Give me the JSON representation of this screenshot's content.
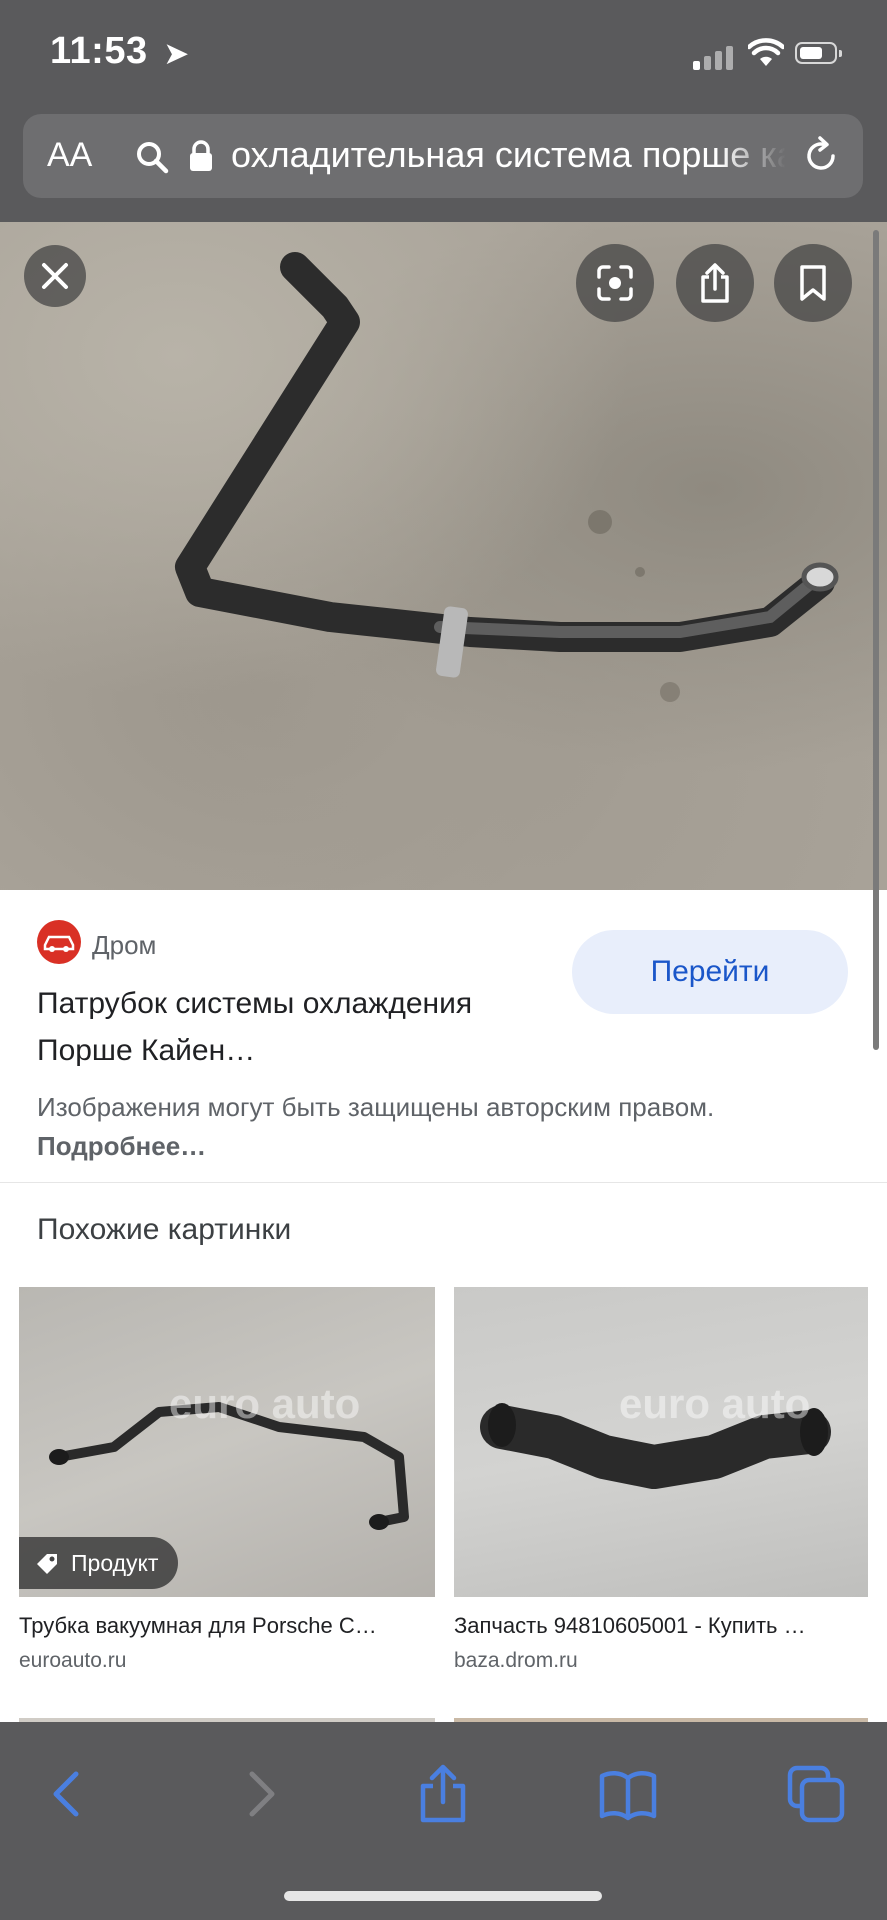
{
  "status_bar": {
    "time": "11:53",
    "location_glyph": "➤"
  },
  "address_bar": {
    "text_size_label": "AA",
    "url_text": "охладительная система порше кайен"
  },
  "image_viewer": {
    "close_icon": "close-icon",
    "lens_icon": "lens-icon",
    "share_icon": "share-icon",
    "bookmark_icon": "bookmark-icon"
  },
  "result": {
    "source": "Дром",
    "title": "Патрубок системы охлаждения Порше Кайен…",
    "visit_label": "Перейти",
    "copyright_text": "Изображения могут быть защищены авторским правом.",
    "more_link": "Подробнее…"
  },
  "similar": {
    "heading": "Похожие картинки",
    "items": [
      {
        "title": "Трубка вакуумная для Porsche C…",
        "site": "euroauto.ru",
        "badge": "Продукт",
        "watermark": "euro auto"
      },
      {
        "title": "Запчасть 94810605001 - Купить …",
        "site": "baza.drom.ru",
        "watermark": "euro auto"
      }
    ]
  },
  "colors": {
    "chrome": "#5a5a5c",
    "accent_blue": "#1a56c9",
    "visit_bg": "#e8eefb",
    "toolbar_icon": "#4a7fe0"
  }
}
